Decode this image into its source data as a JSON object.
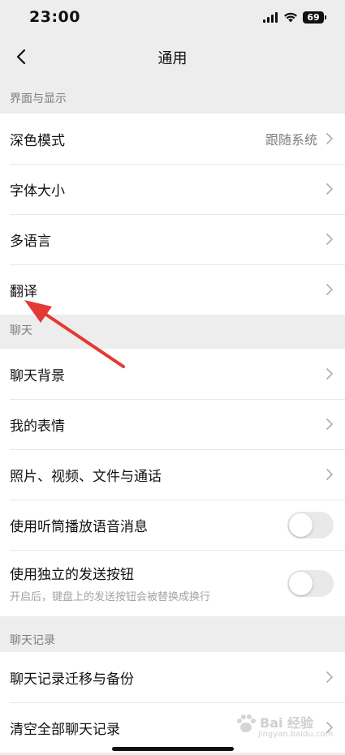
{
  "status_bar": {
    "time": "23:00",
    "battery": "69"
  },
  "nav": {
    "title": "通用"
  },
  "sections": {
    "display": {
      "header": "界面与显示",
      "rows": [
        {
          "label": "深色模式",
          "value": "跟随系统"
        },
        {
          "label": "字体大小"
        },
        {
          "label": "多语言"
        },
        {
          "label": "翻译"
        }
      ]
    },
    "chat": {
      "header": "聊天",
      "rows": [
        {
          "label": "聊天背景"
        },
        {
          "label": "我的表情"
        },
        {
          "label": "照片、视频、文件与通话"
        },
        {
          "label": "使用听筒播放语音消息",
          "toggle": false
        },
        {
          "label": "使用独立的发送按钮",
          "sub": "开启后，键盘上的发送按钮会被替换成换行",
          "toggle": false
        }
      ]
    },
    "history": {
      "header": "聊天记录",
      "rows": [
        {
          "label": "聊天记录迁移与备份"
        },
        {
          "label": "清空全部聊天记录"
        }
      ]
    }
  },
  "watermark": {
    "text": "Bai 经验",
    "sub": "jingyan.baidu.com"
  },
  "colors": {
    "background": "#ededed",
    "annotation_arrow": "#e53935",
    "toggle_off": "#e9e9ea"
  }
}
